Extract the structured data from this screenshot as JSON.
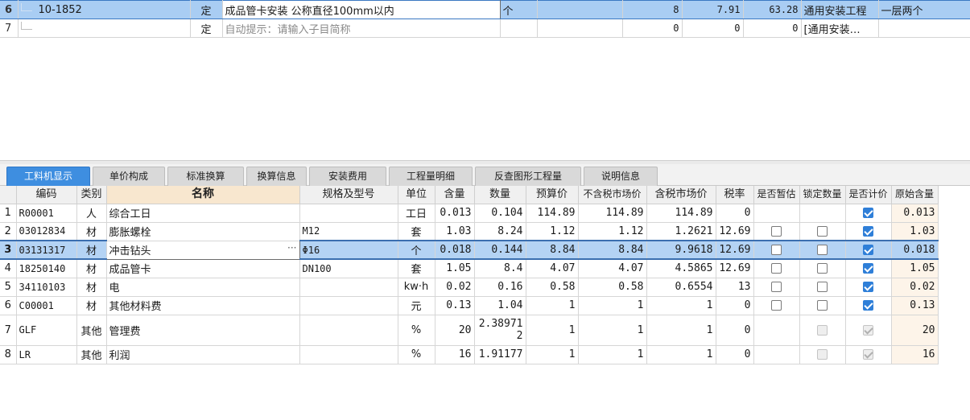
{
  "top_rows": [
    {
      "row": "6",
      "code": "10-1852",
      "type": "定",
      "name": "成品管卡安装 公称直径100mm以内",
      "unit": "个",
      "blank": "",
      "qty": "8",
      "price": "7.91",
      "total": "63.28",
      "category": "通用安装工程",
      "extra": "一层两个"
    },
    {
      "row": "7",
      "code": "",
      "type": "定",
      "name": "自动提示：请输入子目简称",
      "unit": "",
      "blank": "",
      "qty": "0",
      "price": "0",
      "total": "0",
      "category": "[通用安装…",
      "extra": ""
    }
  ],
  "tabs": [
    {
      "label": "工料机显示",
      "active": true
    },
    {
      "label": "单价构成",
      "active": false
    },
    {
      "label": "标准换算",
      "active": false
    },
    {
      "label": "换算信息",
      "active": false
    },
    {
      "label": "安装费用",
      "active": false
    },
    {
      "label": "工程量明细",
      "active": false
    },
    {
      "label": "反查图形工程量",
      "active": false
    },
    {
      "label": "说明信息",
      "active": false
    }
  ],
  "columns": {
    "rownum": "",
    "code": "编码",
    "kind": "类别",
    "name": "名称",
    "spec": "规格及型号",
    "unit": "单位",
    "content": "含量",
    "qty": "数量",
    "budget_price": "预算价",
    "market_ex_tax": "不含税市场价",
    "market_inc_tax": "含税市场价",
    "tax_rate": "税率",
    "provisional": "是否暂估",
    "lock_qty": "锁定数量",
    "is_priced": "是否计价",
    "original_content": "原始含量"
  },
  "materials": [
    {
      "row": "1",
      "code": "R00001",
      "kind": "人",
      "name": "综合工日",
      "spec": "",
      "unit": "工日",
      "content": "0.013",
      "qty": "0.104",
      "budget_price": "114.89",
      "market_ex_tax": "114.89",
      "market_inc_tax": "114.89",
      "tax_rate": "0",
      "provisional": null,
      "lock_qty": null,
      "is_priced": true,
      "disabled": false,
      "original_content": "0.013"
    },
    {
      "row": "2",
      "code": "03012834",
      "kind": "材",
      "name": "膨胀螺栓",
      "spec": "M12",
      "unit": "套",
      "content": "1.03",
      "qty": "8.24",
      "budget_price": "1.12",
      "market_ex_tax": "1.12",
      "market_inc_tax": "1.2621",
      "tax_rate": "12.69",
      "provisional": false,
      "lock_qty": false,
      "is_priced": true,
      "disabled": false,
      "original_content": "1.03"
    },
    {
      "row": "3",
      "code": "03131317",
      "kind": "材",
      "name": "冲击钻头",
      "spec": "Φ16",
      "unit": "个",
      "content": "0.018",
      "qty": "0.144",
      "budget_price": "8.84",
      "market_ex_tax": "8.84",
      "market_inc_tax": "9.9618",
      "tax_rate": "12.69",
      "provisional": false,
      "lock_qty": false,
      "is_priced": true,
      "disabled": false,
      "original_content": "0.018",
      "selected": true
    },
    {
      "row": "4",
      "code": "18250140",
      "kind": "材",
      "name": "成品管卡",
      "spec": "DN100",
      "unit": "套",
      "content": "1.05",
      "qty": "8.4",
      "budget_price": "4.07",
      "market_ex_tax": "4.07",
      "market_inc_tax": "4.5865",
      "tax_rate": "12.69",
      "provisional": false,
      "lock_qty": false,
      "is_priced": true,
      "disabled": false,
      "original_content": "1.05"
    },
    {
      "row": "5",
      "code": "34110103",
      "kind": "材",
      "name": "电",
      "spec": "",
      "unit": "kw·h",
      "content": "0.02",
      "qty": "0.16",
      "budget_price": "0.58",
      "market_ex_tax": "0.58",
      "market_inc_tax": "0.6554",
      "tax_rate": "13",
      "provisional": false,
      "lock_qty": false,
      "is_priced": true,
      "disabled": false,
      "original_content": "0.02"
    },
    {
      "row": "6",
      "code": "C00001",
      "kind": "材",
      "name": "其他材料费",
      "spec": "",
      "unit": "元",
      "content": "0.13",
      "qty": "1.04",
      "budget_price": "1",
      "market_ex_tax": "1",
      "market_inc_tax": "1",
      "tax_rate": "0",
      "provisional": false,
      "lock_qty": false,
      "is_priced": true,
      "disabled": false,
      "original_content": "0.13"
    },
    {
      "row": "7",
      "code": "GLF",
      "kind": "其他",
      "name": "管理费",
      "spec": "",
      "unit": "%",
      "content": "20",
      "qty": "2.389712",
      "budget_price": "1",
      "market_ex_tax": "1",
      "market_inc_tax": "1",
      "tax_rate": "0",
      "provisional": null,
      "lock_qty": false,
      "is_priced": true,
      "disabled": true,
      "original_content": "20",
      "tall": true
    },
    {
      "row": "8",
      "code": "LR",
      "kind": "其他",
      "name": "利润",
      "spec": "",
      "unit": "%",
      "content": "16",
      "qty": "1.91177",
      "budget_price": "1",
      "market_ex_tax": "1",
      "market_inc_tax": "1",
      "tax_rate": "0",
      "provisional": null,
      "lock_qty": false,
      "is_priced": true,
      "disabled": true,
      "original_content": "16"
    }
  ],
  "ellipsis_glyph": "···",
  "colors": {
    "active_tab": "#3e8ee0",
    "selected_row": "#b4d3f4",
    "checkbox": "#2f7fd8",
    "name_header": "#f8e7cf"
  }
}
